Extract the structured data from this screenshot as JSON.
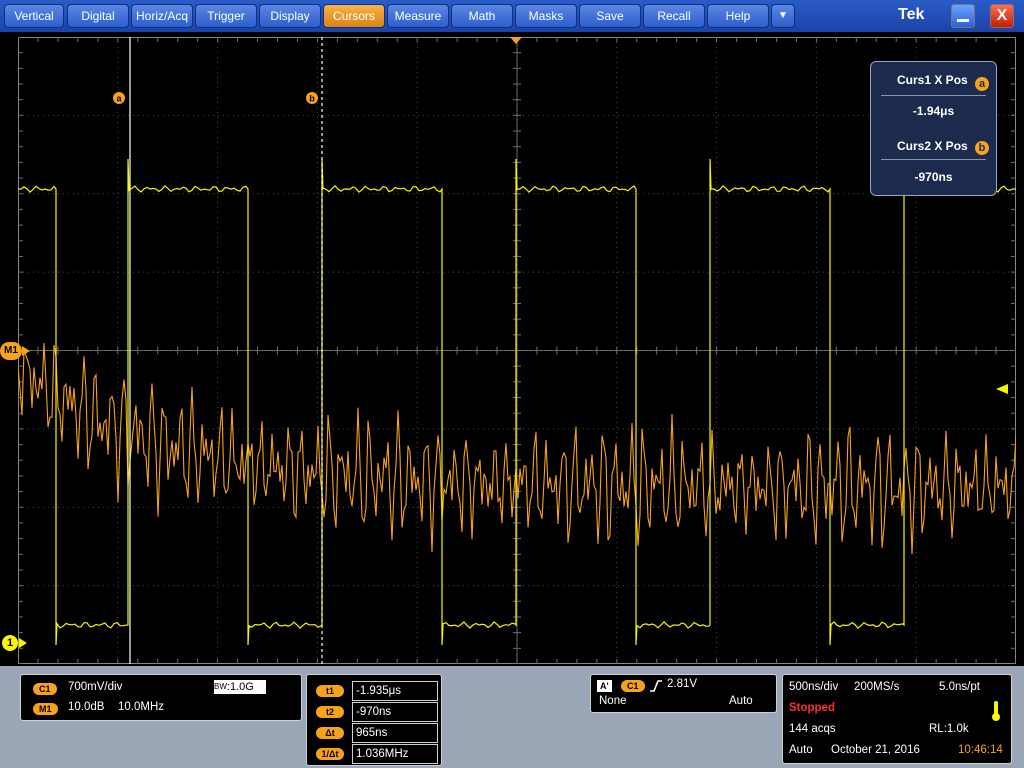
{
  "menu": {
    "items": [
      "Vertical",
      "Digital",
      "Horiz/Acq",
      "Trigger",
      "Display",
      "Cursors",
      "Measure",
      "Math",
      "Masks",
      "Save",
      "Recall",
      "Help"
    ],
    "active": "Cursors",
    "dropdown_glyph": "▼",
    "brand": "Tek",
    "close_glyph": "X"
  },
  "colors": {
    "channel1": "#f7f700",
    "math": "#f7a21b",
    "panel_bg": "#1c2a4e",
    "bar_blue": "#2a5cc7"
  },
  "screen": {
    "cursor_a_label": "a",
    "cursor_b_label": "b",
    "math_marker": "M1",
    "channel_marker": "1"
  },
  "cursor_readout": {
    "curs1_label": "Curs1 X Pos",
    "curs1_value": "-1.94μs",
    "curs1_badge": "a",
    "curs2_label": "Curs2 X Pos",
    "curs2_value": "-970ns",
    "curs2_badge": "b"
  },
  "vertical": {
    "c1_tag": "C1",
    "c1_scale": "700mV/div",
    "bw_prefix": "B",
    "bw_sub": "W",
    "bw_value": ":1.0G",
    "m1_tag": "M1",
    "m1_scale": "10.0dB",
    "m1_span": "10.0MHz"
  },
  "cursors_panel": {
    "rows": [
      {
        "tag": "t1",
        "value": "-1.935μs"
      },
      {
        "tag": "t2",
        "value": "-970ns"
      },
      {
        "tag": "Δt",
        "value": "965ns"
      },
      {
        "tag": "1/Δt",
        "value": "1.036MHz"
      }
    ]
  },
  "trigger": {
    "a_tag": "A'",
    "source": "C1",
    "slope_icon": "rising-edge-icon",
    "level": "2.81V",
    "coupling": "None",
    "mode": "Auto"
  },
  "acquisition": {
    "timebase": "500ns/div",
    "sample_rate": "200MS/s",
    "resolution": "5.0ns/pt",
    "state": "Stopped",
    "acqs": "144 acqs",
    "record_length": "RL:1.0k",
    "run_mode": "Auto",
    "date": "October 21, 2016",
    "time": "10:46:14"
  }
}
